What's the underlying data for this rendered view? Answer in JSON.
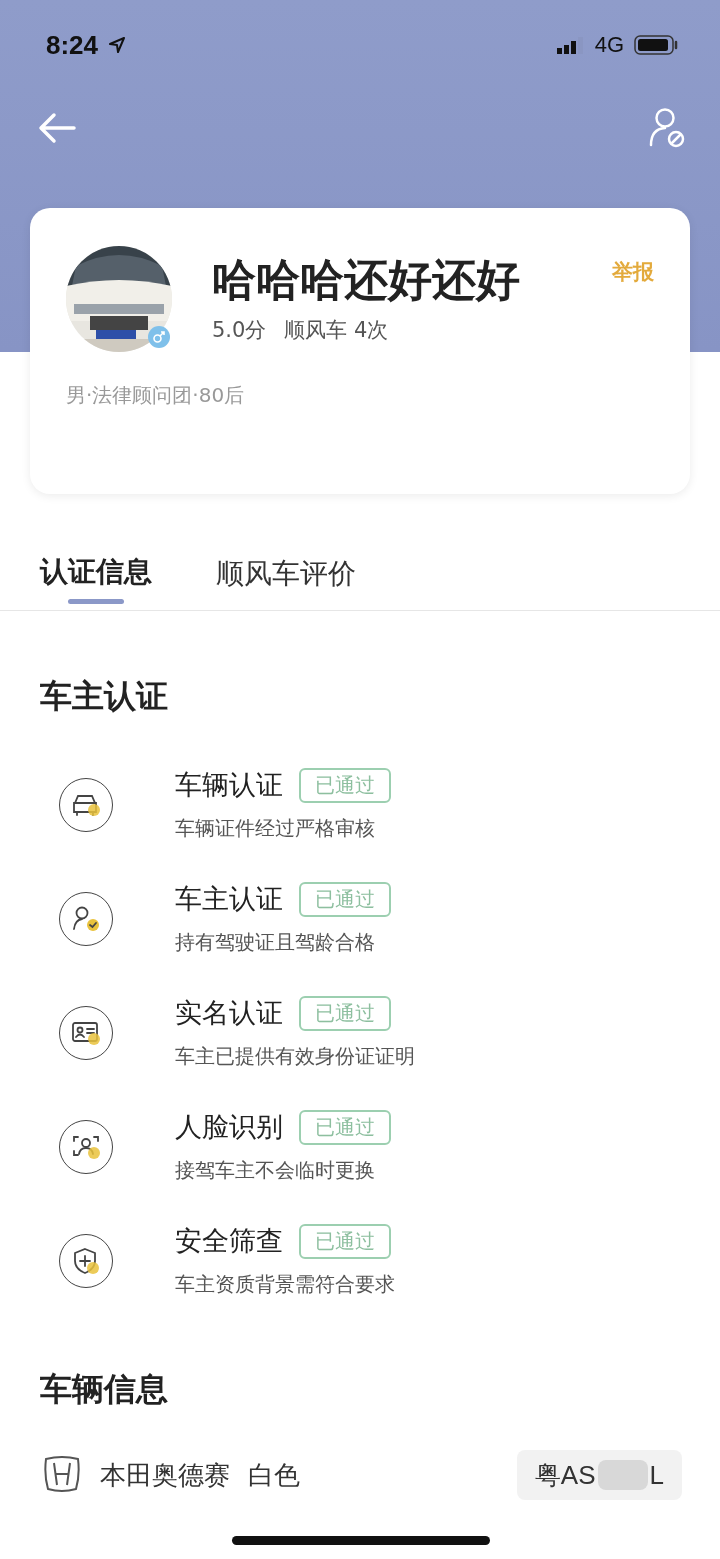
{
  "status_bar": {
    "time": "8:24",
    "network": "4G"
  },
  "profile": {
    "name": "哈哈哈还好还好",
    "rating": "5.0分",
    "rides": "顺风车 4次",
    "report": "举报",
    "details": "男·法律顾问团·80后"
  },
  "tabs": [
    {
      "label": "认证信息",
      "selected": true
    },
    {
      "label": "顺风车评价",
      "selected": false
    }
  ],
  "owner_verification": {
    "title": "车主认证",
    "items": [
      {
        "kind": "car",
        "title": "车辆认证",
        "badge": "已通过",
        "description": "车辆证件经过严格审核"
      },
      {
        "kind": "person",
        "title": "车主认证",
        "badge": "已通过",
        "description": "持有驾驶证且驾龄合格"
      },
      {
        "kind": "id",
        "title": "实名认证",
        "badge": "已通过",
        "description": "车主已提供有效身份证证明"
      },
      {
        "kind": "face",
        "title": "人脸识别",
        "badge": "已通过",
        "description": "接驾车主不会临时更换"
      },
      {
        "kind": "shield",
        "title": "安全筛查",
        "badge": "已通过",
        "description": "车主资质背景需符合要求"
      }
    ]
  },
  "vehicle_info": {
    "title": "车辆信息",
    "model": "本田奥德赛",
    "paint": "白色",
    "plate_start": "粤AS",
    "plate_end": "L"
  }
}
